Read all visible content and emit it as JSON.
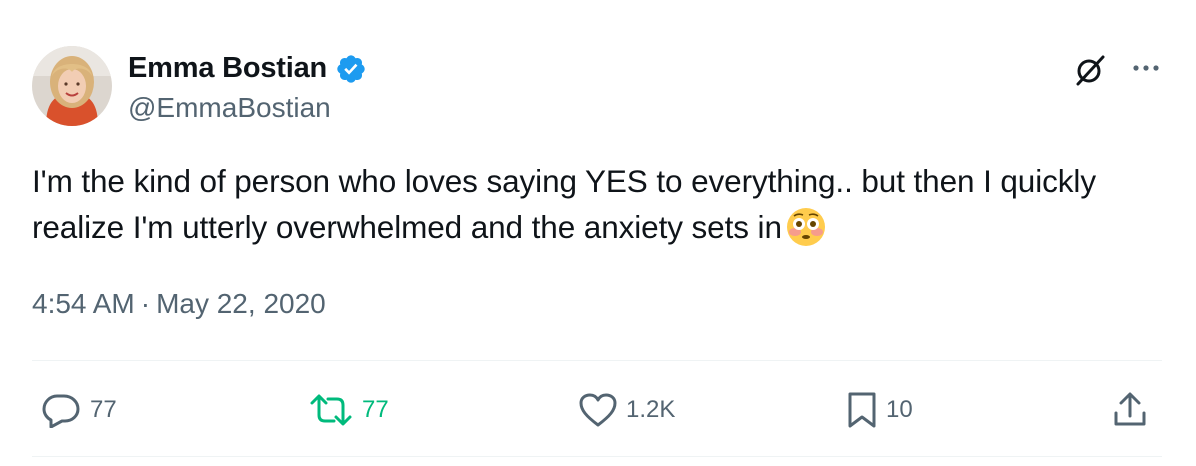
{
  "author": {
    "name": "Emma Bostian",
    "handle": "@EmmaBostian",
    "verified": true
  },
  "tweet": {
    "text": "I'm the kind of person who loves saying YES to everything.. but then I quickly realize I'm utterly overwhelmed and the anxiety sets in",
    "emoji": "flushed-face",
    "time": "4:54 AM",
    "separator": "·",
    "date": "May 22, 2020"
  },
  "actions": {
    "reply_count": "77",
    "retweet_count": "77",
    "like_count": "1.2K",
    "bookmark_count": "10"
  },
  "colors": {
    "text": "#0f1419",
    "secondary": "#536471",
    "verified": "#1d9bf0",
    "retweet": "#00ba7c",
    "divider": "#eff3f4"
  },
  "icons": [
    "verified-badge-icon",
    "grok-icon",
    "more-icon",
    "reply-icon",
    "retweet-icon",
    "like-icon",
    "bookmark-icon",
    "share-icon"
  ]
}
